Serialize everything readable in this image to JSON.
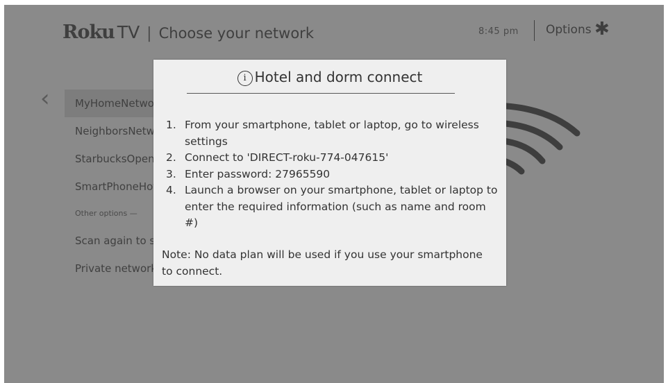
{
  "header": {
    "brand_roku": "Roku",
    "brand_tv": "TV",
    "separator": "|",
    "title": "Choose your network",
    "time": "8:45  pm",
    "options_label": "Options",
    "options_icon": "✱"
  },
  "nav": {
    "back_icon": "《"
  },
  "networks": [
    {
      "label": "MyHomeNetwork",
      "selected": true
    },
    {
      "label": "NeighborsNetwork"
    },
    {
      "label": "StarbucksOpen"
    },
    {
      "label": "SmartPhoneHotspot"
    }
  ],
  "other_options_label": "Other options —",
  "actions": [
    {
      "label": "Scan again to see all networks"
    },
    {
      "label": "Private network"
    }
  ],
  "modal": {
    "info_icon": "i",
    "title": "Hotel and dorm connect",
    "steps": [
      {
        "num": "1.",
        "text": "From your smartphone, tablet or laptop, go to wireless settings"
      },
      {
        "num": "2.",
        "text": "Connect to 'DIRECT-roku-774-047615'"
      },
      {
        "num": "3.",
        "text": "Enter password: 27965590"
      },
      {
        "num": "4.",
        "text": "Launch a browser on your smartphone, tablet or laptop to enter the required information (such as name and room #)"
      }
    ],
    "note": "Note: No data plan will be used if you use your smartphone to connect."
  },
  "colors": {
    "background_dim": "#8a8a8a",
    "modal_bg": "#efefef",
    "text_dark": "#333333"
  }
}
